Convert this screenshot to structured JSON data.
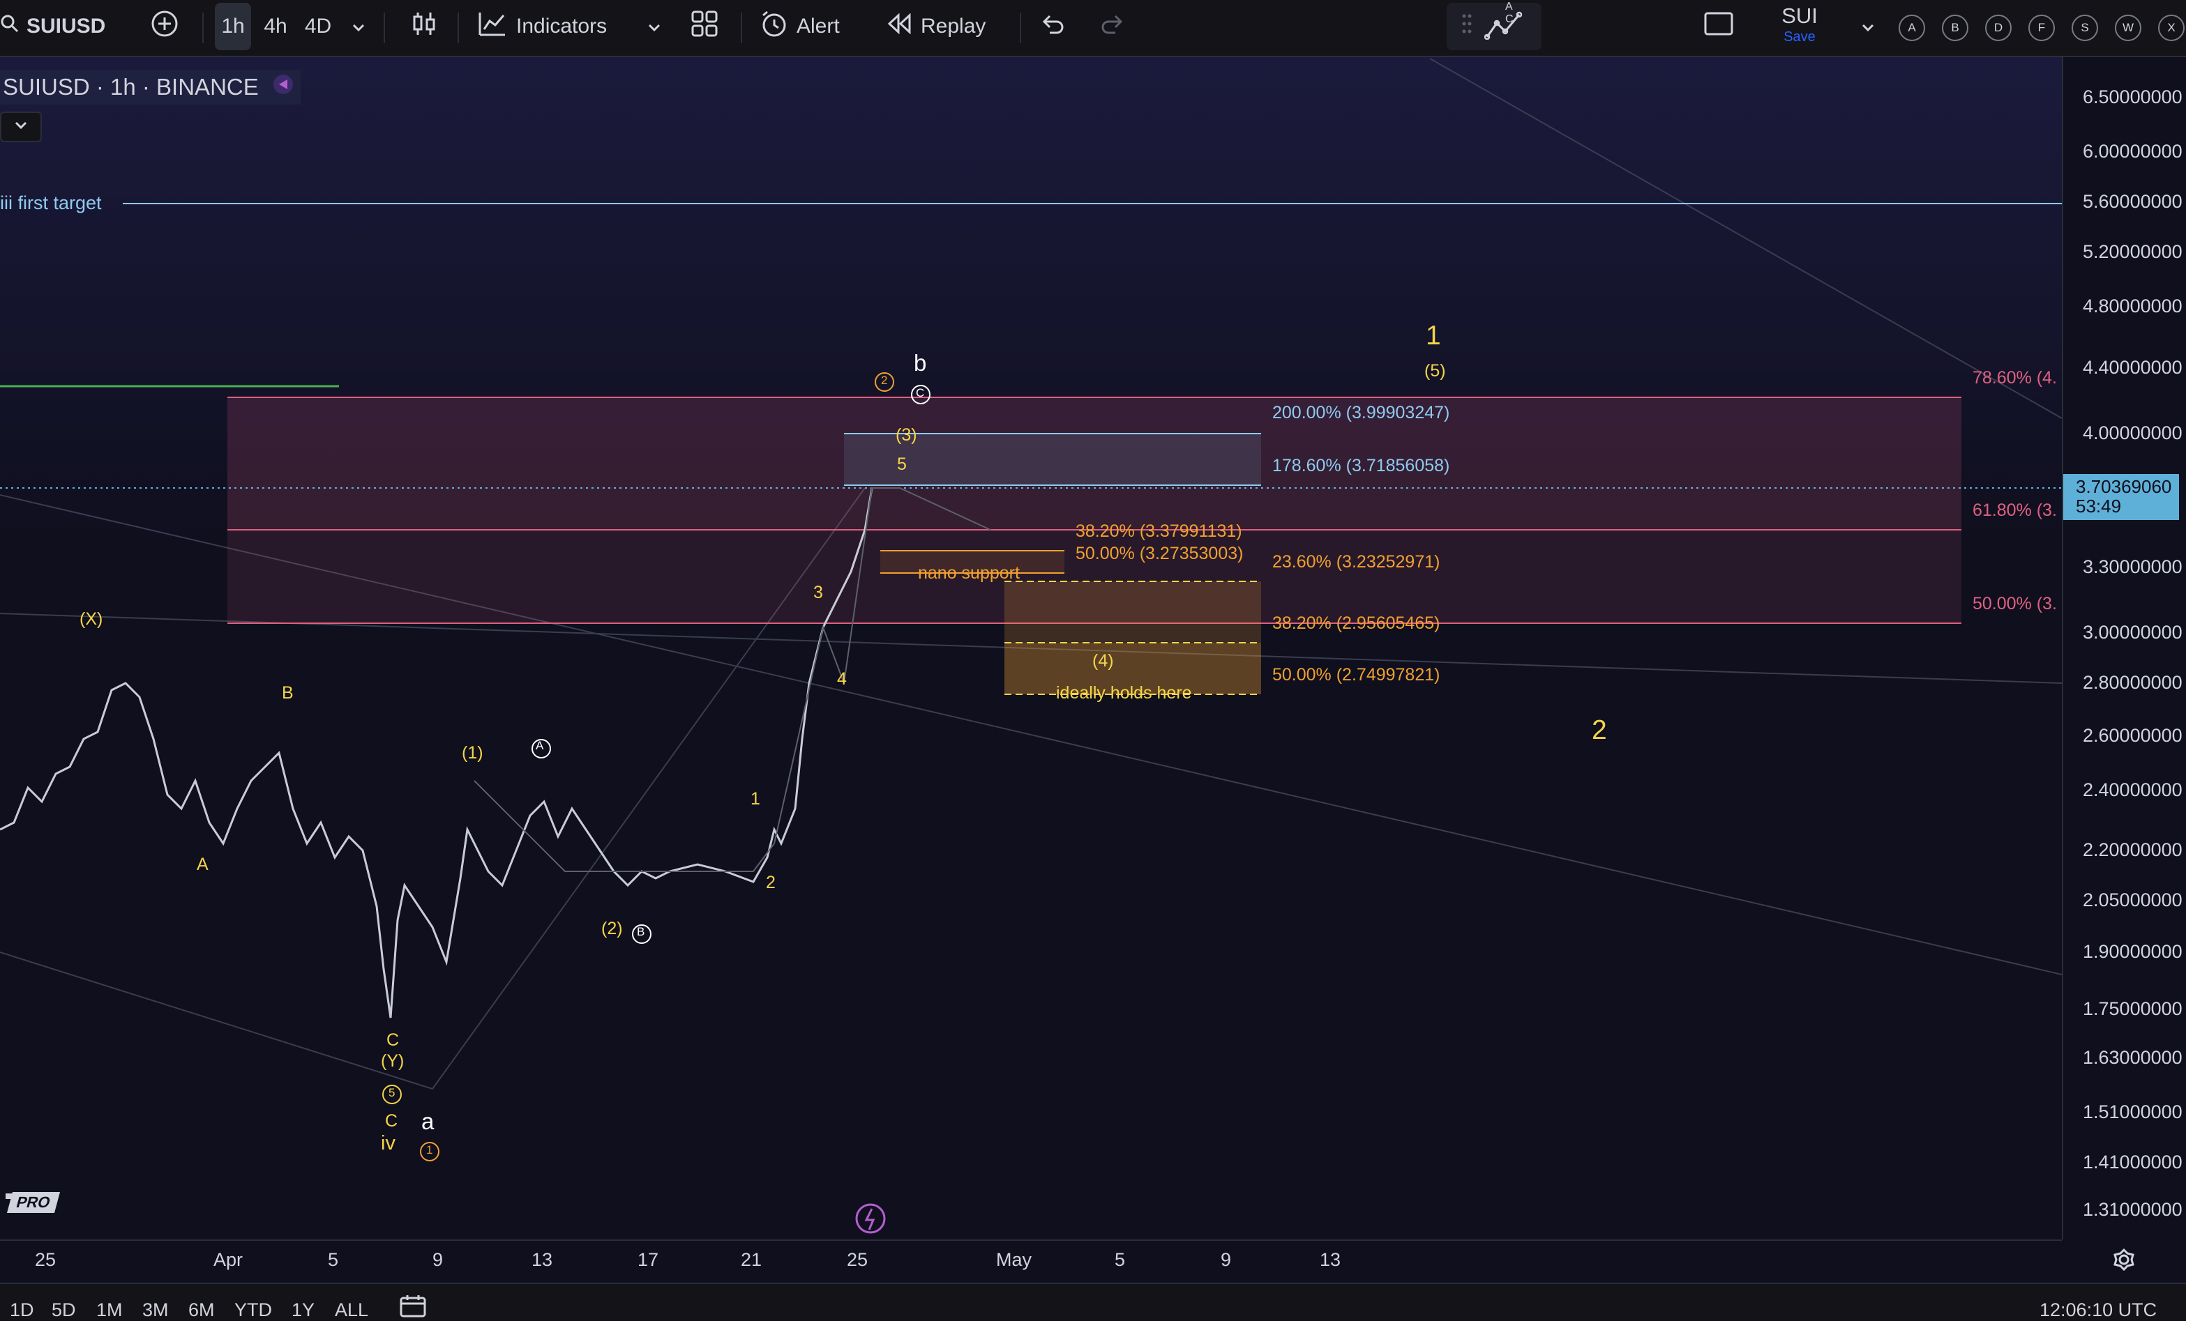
{
  "toolbar": {
    "symbol": "SUIUSD",
    "intervals": [
      "1h",
      "4h",
      "4D"
    ],
    "indicators_label": "Indicators",
    "alert_label": "Alert",
    "replay_label": "Replay",
    "layout_name": "SUI",
    "save_label": "Save",
    "ac_label": "A C",
    "letter_buttons": [
      "A",
      "B",
      "D",
      "F",
      "S",
      "W",
      "X"
    ]
  },
  "legend": {
    "title": "SUIUSD · 1h · BINANCE"
  },
  "price_axis": {
    "labels": [
      "6.50000000",
      "6.00000000",
      "5.60000000",
      "5.20000000",
      "4.80000000",
      "4.40000000",
      "4.00000000",
      "3.30000000",
      "3.00000000",
      "2.80000000",
      "2.60000000",
      "2.40000000",
      "2.20000000",
      "2.05000000",
      "1.90000000",
      "1.75000000",
      "1.63000000",
      "1.51000000",
      "1.41000000",
      "1.31000000"
    ],
    "current_price": "3.70369060",
    "countdown": "53:49"
  },
  "time_axis": {
    "labels": [
      "25",
      "Apr",
      "5",
      "9",
      "13",
      "17",
      "21",
      "25",
      "May",
      "5",
      "9",
      "13"
    ]
  },
  "bottom": {
    "ranges": [
      "1D",
      "5D",
      "1M",
      "3M",
      "6M",
      "YTD",
      "1Y",
      "ALL"
    ],
    "clock": "12:06:10 UTC"
  },
  "annotations": {
    "iii_first_target": "iii first target",
    "fib_200": "200.00% (3.99903247)",
    "fib_1786": "178.60% (3.71856058)",
    "fib_382_a": "38.20% (3.37991131)",
    "fib_500_a": "50.00% (3.27353003)",
    "nano_support": "nano support",
    "fib_236": "23.60% (3.23252971)",
    "fib_382_b": "38.20% (2.95605465)",
    "fib_500_b": "50.00% (2.74997821)",
    "ideally_holds": "ideally holds here",
    "fib_786_r": "78.60% (4.",
    "fib_618_r": "61.80% (3.",
    "fib_500_r": "50.00% (3.",
    "wave_4": "(4)",
    "wave_3p": "(3)",
    "wave_5": "5",
    "wave_3": "3",
    "wave_4s": "4",
    "wave_1": "1",
    "wave_2": "2",
    "wave_b": "b",
    "wave_X": "(X)",
    "wave_B": "B",
    "wave_A": "A",
    "wave_1p": "(1)",
    "wave_2p": "(2)",
    "wave_C": "C",
    "wave_Y": "(Y)",
    "wave_C2": "C",
    "wave_iv": "iv",
    "wave_a": "a",
    "wave_big1": "1",
    "wave_5p": "(5)",
    "wave_big2": "2",
    "circle_A": "A",
    "circle_B": "B",
    "circle_C": "C",
    "circle_2": "2",
    "circle_5": "5",
    "circle_1": "1",
    "pro": "PRO"
  },
  "colors": {
    "background": "#0f0f1e",
    "yellow": "#f5d547",
    "orange": "#f0a030",
    "pink_zone": "#e06080",
    "blue": "#8ecbf0",
    "price_tag": "#5fb0d8"
  }
}
